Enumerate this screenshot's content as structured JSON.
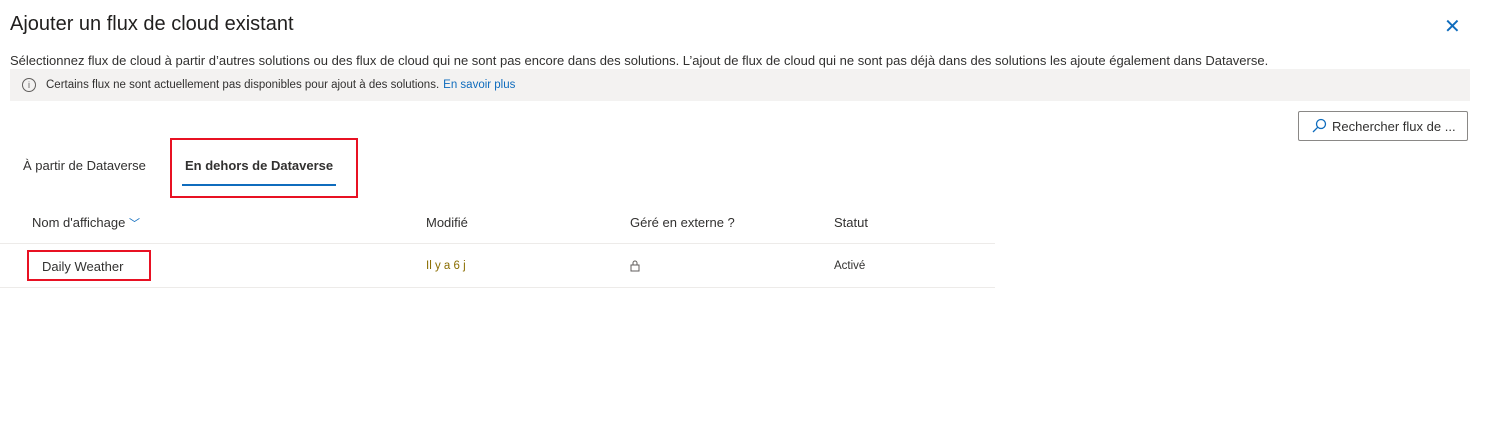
{
  "dialog": {
    "title": "Ajouter un flux de cloud existant",
    "close_icon": "close-icon",
    "description": "Sélectionnez flux de cloud à partir d’autres solutions ou des flux de cloud qui ne sont pas encore dans des solutions. L’ajout de flux de cloud qui ne sont pas déjà dans des solutions les ajoute également dans Dataverse."
  },
  "banner": {
    "text": "Certains flux ne sont actuellement pas disponibles pour ajout à des solutions.",
    "link": "En savoir plus"
  },
  "search": {
    "placeholder": "Rechercher flux de ..."
  },
  "tabs": [
    {
      "label": "À partir de Dataverse"
    },
    {
      "label": "En dehors de Dataverse",
      "selected": true
    }
  ],
  "table": {
    "columns": [
      "Nom d'affichage",
      "Modifié",
      "Géré en externe ?",
      "Statut"
    ],
    "rows": [
      {
        "name": "Daily Weather",
        "modified": "Il y a 6 j",
        "managed_icon": "lock-icon",
        "status": "Activé"
      }
    ]
  },
  "colors": {
    "accent": "#0f6cbd",
    "highlight": "#e81123"
  }
}
